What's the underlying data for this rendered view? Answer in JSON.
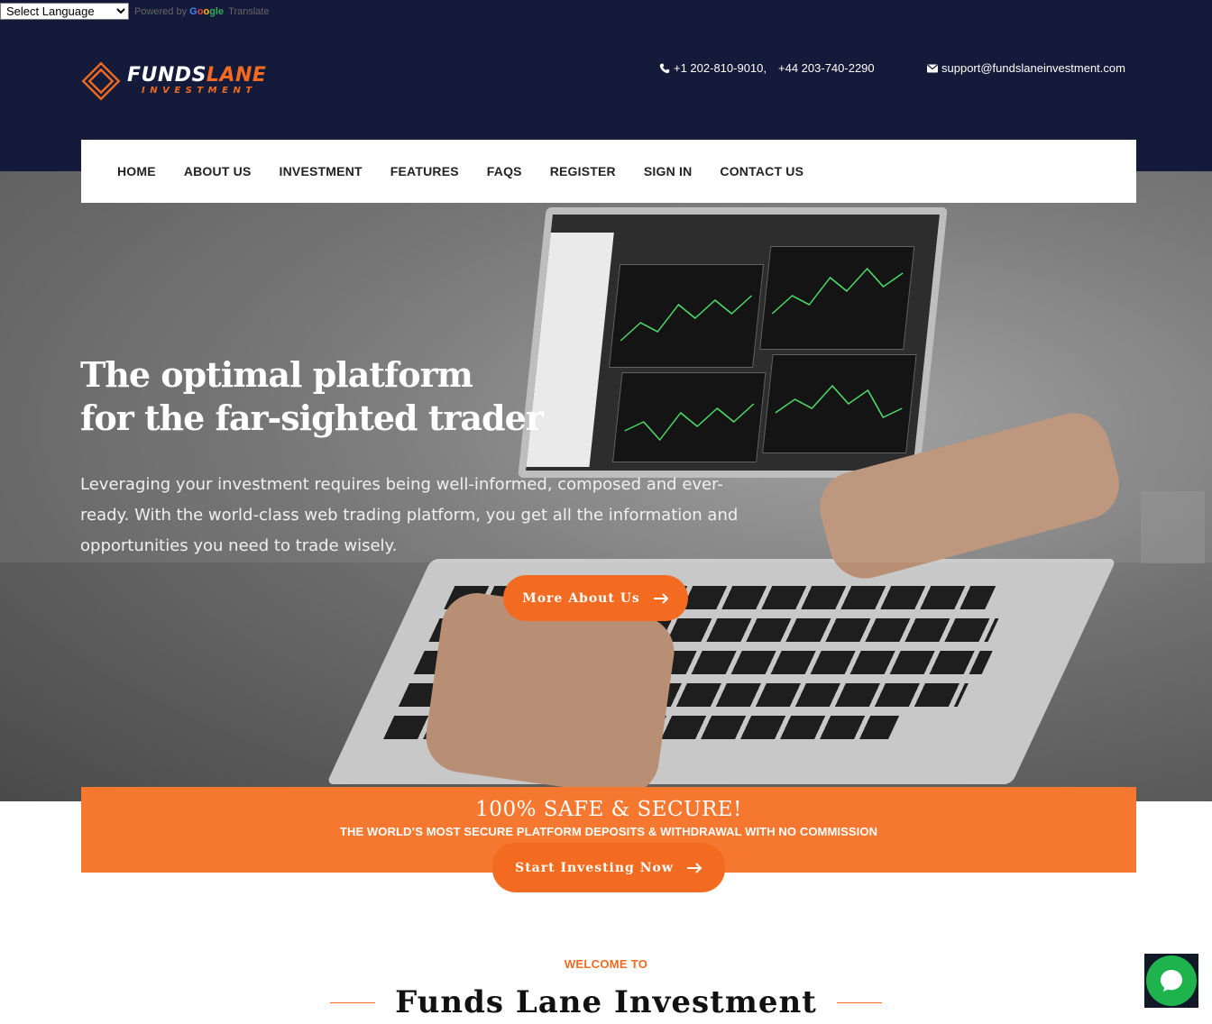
{
  "translate": {
    "select_label": "Select Language",
    "powered_by": "Powered by",
    "google_g1": "G",
    "google_g2": "o",
    "google_g3": "o",
    "google_g4": "gle",
    "translate_label": "Translate"
  },
  "brand": {
    "name_part1": "FUNDS",
    "name_part2": "LANE",
    "tagline": "INVESTMENT",
    "accent_color": "#f26b21",
    "header_bg": "#141a39"
  },
  "contact": {
    "phone_icon": "phone-icon",
    "phone1": "+1 202-810-9010,",
    "phone2": "+44 203-740-2290",
    "mail_icon": "envelope-icon",
    "email": "support@fundslaneinvestment.com"
  },
  "nav": {
    "items": [
      "HOME",
      "ABOUT US",
      "INVESTMENT",
      "FEATURES",
      "FAQS",
      "REGISTER",
      "SIGN IN",
      "CONTACT US"
    ]
  },
  "hero": {
    "title_line1": "The optimal platform",
    "title_line2": "for the far-sighted trader",
    "description": "Leveraging your investment requires being well-informed, composed and ever-ready. With the world-class web trading platform, you get all the information and opportunities you need to trade wisely.",
    "button_label": "More About Us",
    "button_icon": "arrow-right-icon"
  },
  "band": {
    "title": "100% SAFE & SECURE!",
    "subtitle": "THE WORLD’S MOST SECURE PLATFORM DEPOSITS & WITHDRAWAL WITH NO COMMISSION",
    "button_label": "Start Investing Now",
    "button_icon": "arrow-right-icon",
    "color": "#f6772f"
  },
  "welcome": {
    "eyebrow": "WELCOME TO",
    "title": "Funds Lane Investment"
  },
  "chat": {
    "icon": "chat-bubble-icon",
    "color": "#1eb34c"
  }
}
